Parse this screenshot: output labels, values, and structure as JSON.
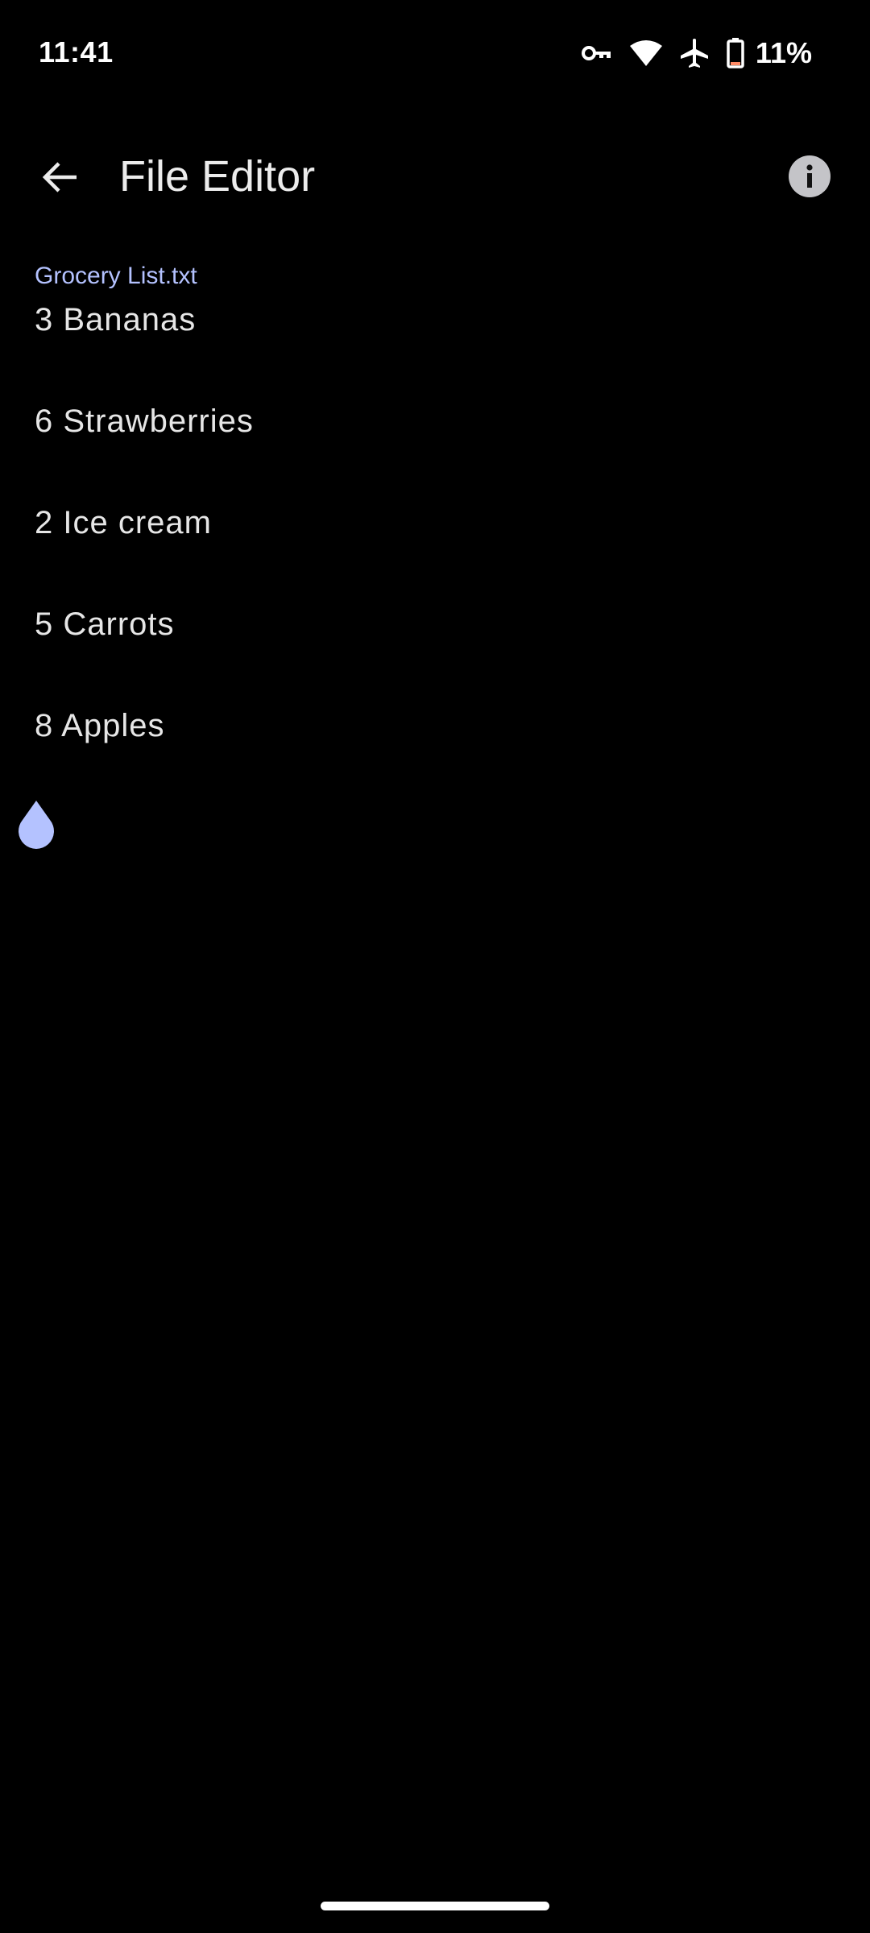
{
  "status_bar": {
    "time": "11:41",
    "battery_percent": "11%",
    "icons": [
      "vpn-key-icon",
      "wifi-icon",
      "airplane-mode-icon",
      "battery-icon"
    ]
  },
  "app_bar": {
    "title": "File Editor",
    "back_icon": "arrow-back-icon",
    "info_icon": "info-icon"
  },
  "editor": {
    "file_name": "Grocery List.txt",
    "lines": [
      "3 Bananas",
      "6 Strawberries",
      "2 Ice cream",
      "5 Carrots",
      "8 Apples",
      ""
    ]
  },
  "colors": {
    "background": "#000000",
    "accent": "#b4c2ff",
    "text": "#e6e6e6",
    "battery_low": "#ff8a65"
  }
}
